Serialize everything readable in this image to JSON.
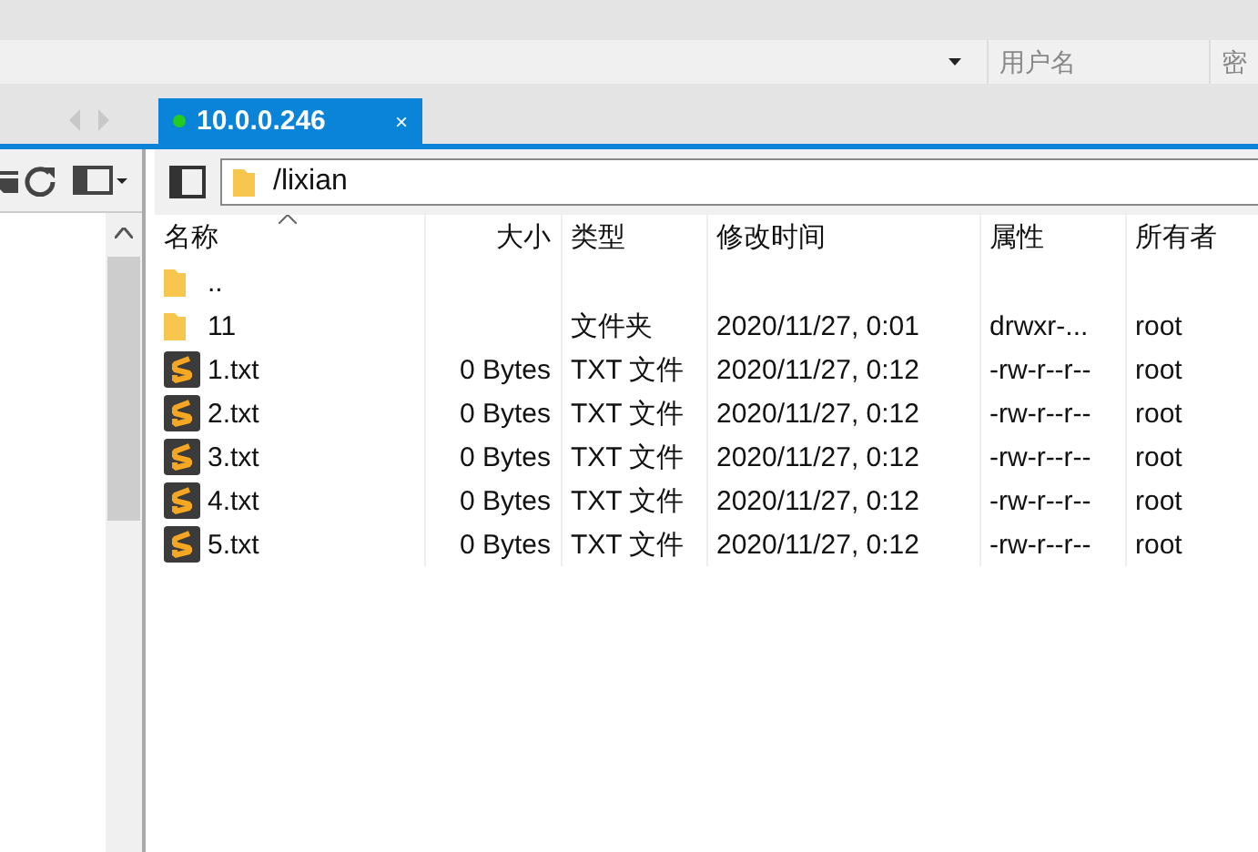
{
  "login_bar": {
    "fields": [
      {
        "placeholder": "用户名"
      },
      {
        "placeholder": "密"
      }
    ]
  },
  "tabs": [
    {
      "label": "10.0.0.246",
      "connected": true,
      "selected": true,
      "close": "×"
    }
  ],
  "path_bar": {
    "path": "/lixian"
  },
  "table": {
    "columns": [
      {
        "label": "名称",
        "sorted": true
      },
      {
        "label": "大小",
        "sorted": false
      },
      {
        "label": "类型",
        "sorted": false
      },
      {
        "label": "修改时间",
        "sorted": false
      },
      {
        "label": "属性",
        "sorted": false
      },
      {
        "label": "所有者",
        "sorted": false
      }
    ],
    "rows": [
      {
        "kind": "folder",
        "cells": [
          "..",
          "",
          "",
          "",
          "",
          ""
        ]
      },
      {
        "kind": "folder",
        "cells": [
          "11",
          "",
          "文件夹",
          "2020/11/27, 0:01",
          "drwxr-...",
          "root"
        ]
      },
      {
        "kind": "file",
        "cells": [
          "1.txt",
          "0 Bytes",
          "TXT 文件",
          "2020/11/27, 0:12",
          "-rw-r--r--",
          "root"
        ]
      },
      {
        "kind": "file",
        "cells": [
          "2.txt",
          "0 Bytes",
          "TXT 文件",
          "2020/11/27, 0:12",
          "-rw-r--r--",
          "root"
        ]
      },
      {
        "kind": "file",
        "cells": [
          "3.txt",
          "0 Bytes",
          "TXT 文件",
          "2020/11/27, 0:12",
          "-rw-r--r--",
          "root"
        ]
      },
      {
        "kind": "file",
        "cells": [
          "4.txt",
          "0 Bytes",
          "TXT 文件",
          "2020/11/27, 0:12",
          "-rw-r--r--",
          "root"
        ]
      },
      {
        "kind": "file",
        "cells": [
          "5.txt",
          "0 Bytes",
          "TXT 文件",
          "2020/11/27, 0:12",
          "-rw-r--r--",
          "root"
        ]
      }
    ]
  }
}
